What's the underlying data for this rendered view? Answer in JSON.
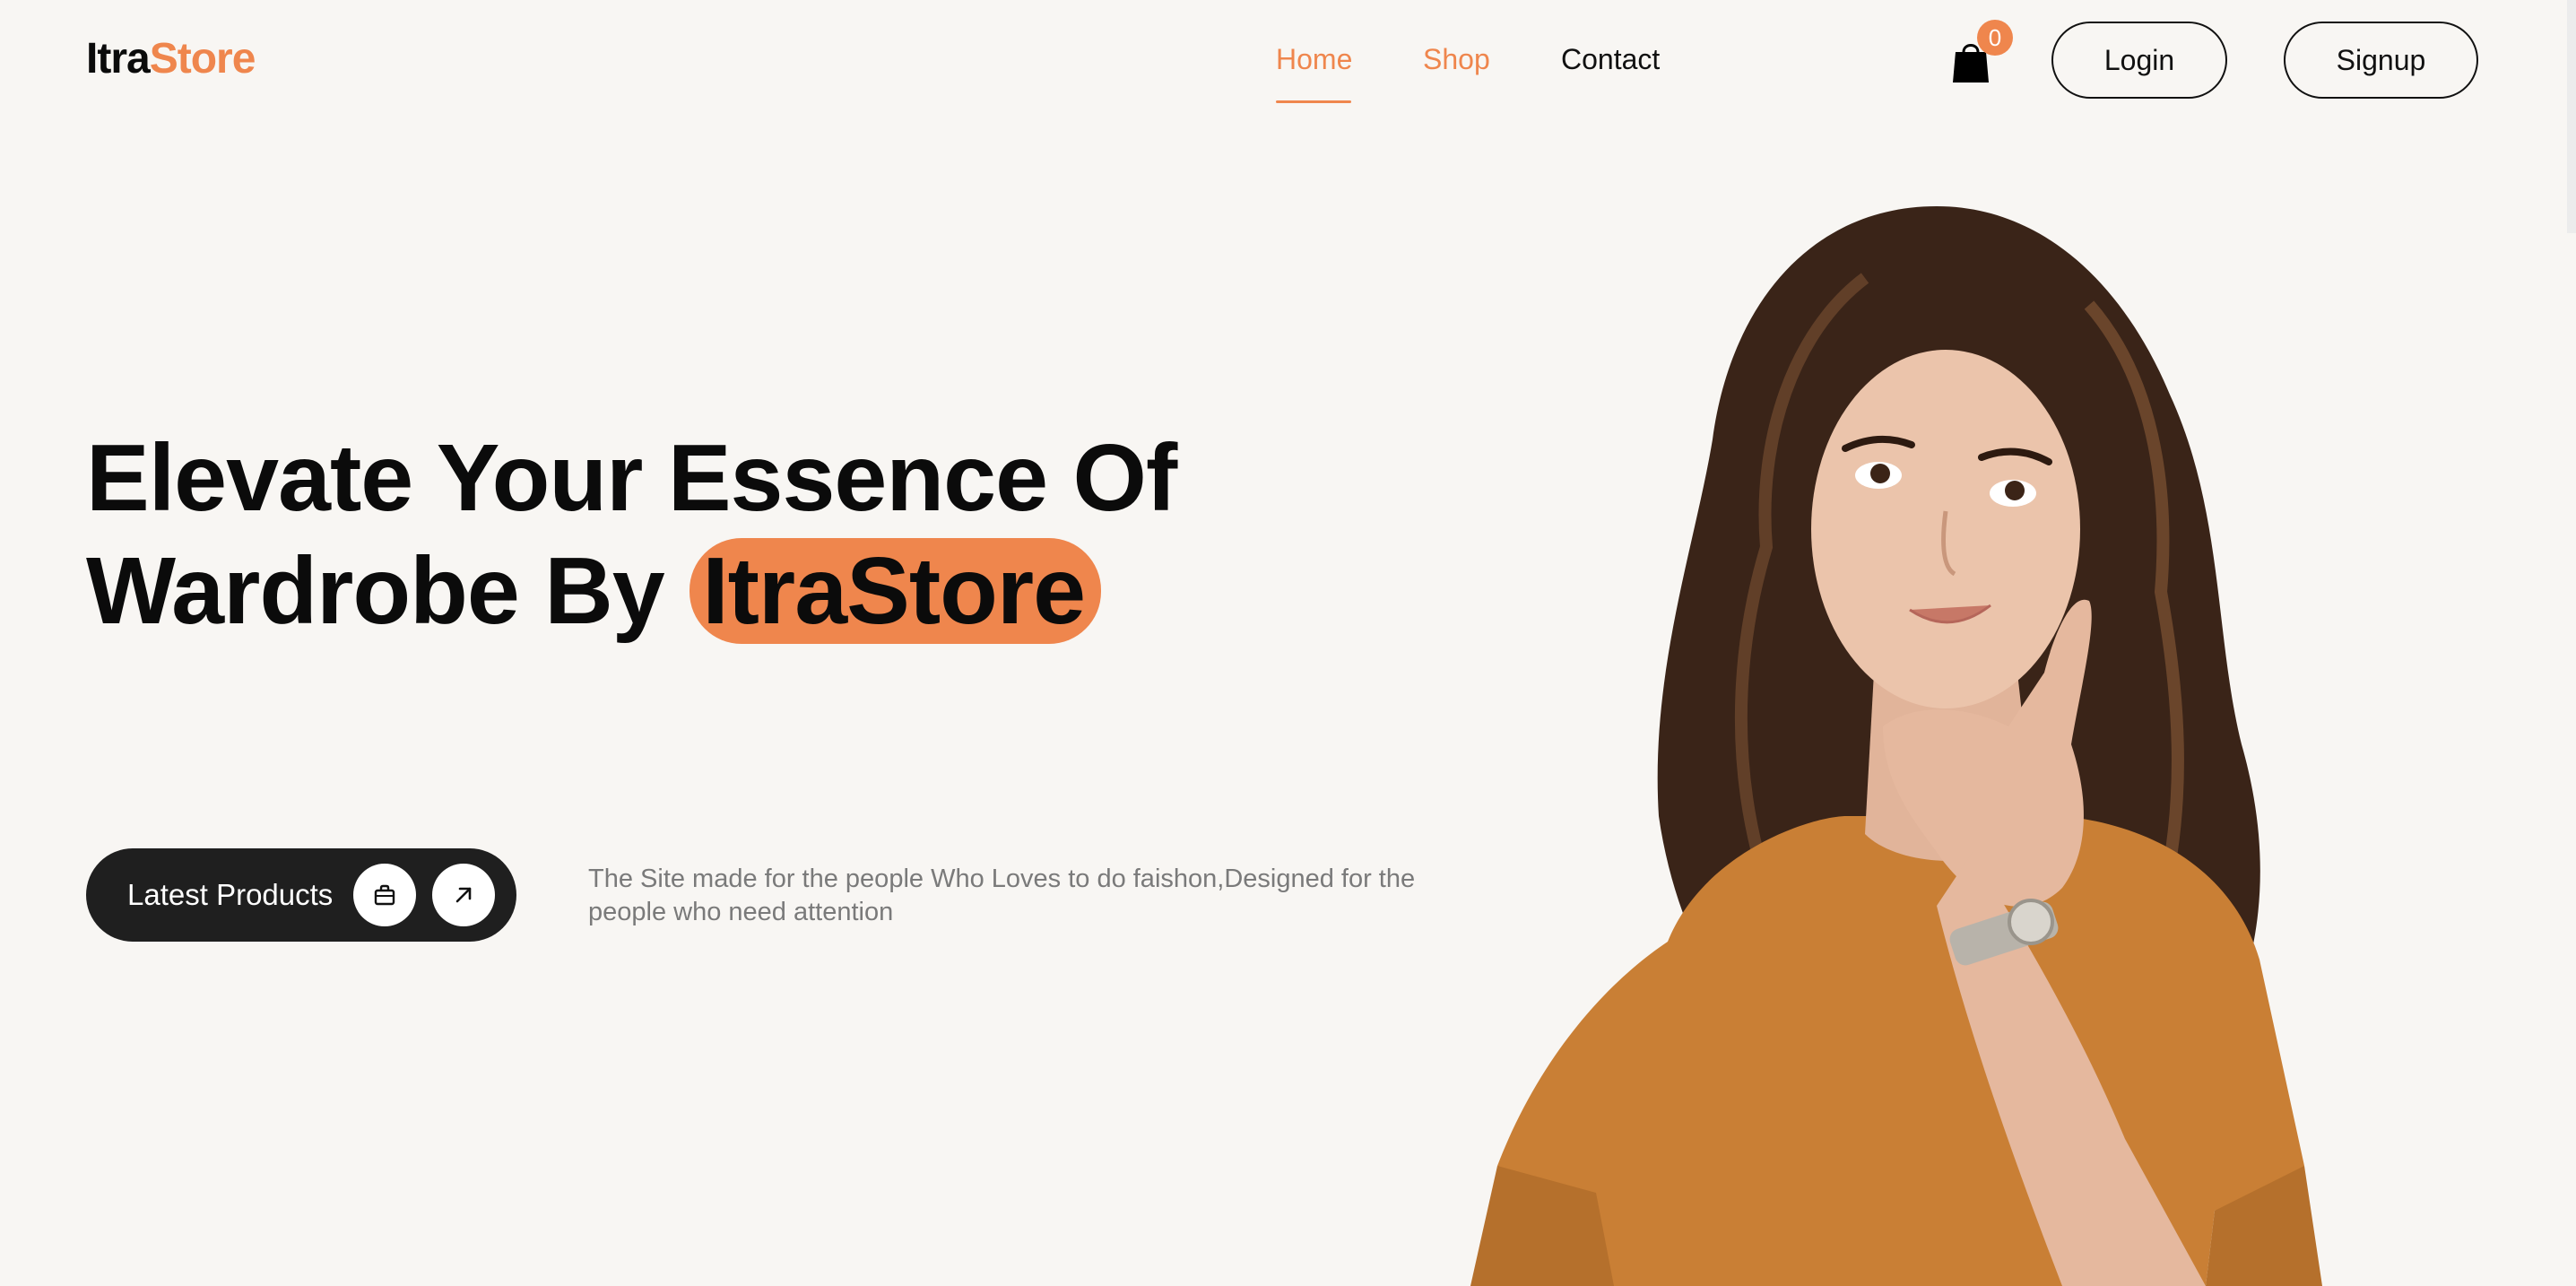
{
  "header": {
    "logo_part1": "Itra",
    "logo_part2": "Store",
    "nav": {
      "home": "Home",
      "shop": "Shop",
      "contact": "Contact"
    },
    "cart_count": "0",
    "login_label": "Login",
    "signup_label": "Signup"
  },
  "hero": {
    "title_line1": "Elevate Your Essence Of",
    "title_line2_prefix": "Wardrobe By",
    "title_highlight": "ItraStore",
    "cta_label": "Latest Products",
    "tagline": "The Site made for the people Who Loves to do faishon,Designed for the people who need attention"
  },
  "icons": {
    "cart": "shopping-bag-icon",
    "cta_bag": "bag-icon",
    "cta_arrow": "arrow-up-right-icon"
  },
  "colors": {
    "accent": "#ef864d",
    "background": "#f8f6f3",
    "dark": "#1f1f1f",
    "muted_text": "#7a7a7a"
  }
}
